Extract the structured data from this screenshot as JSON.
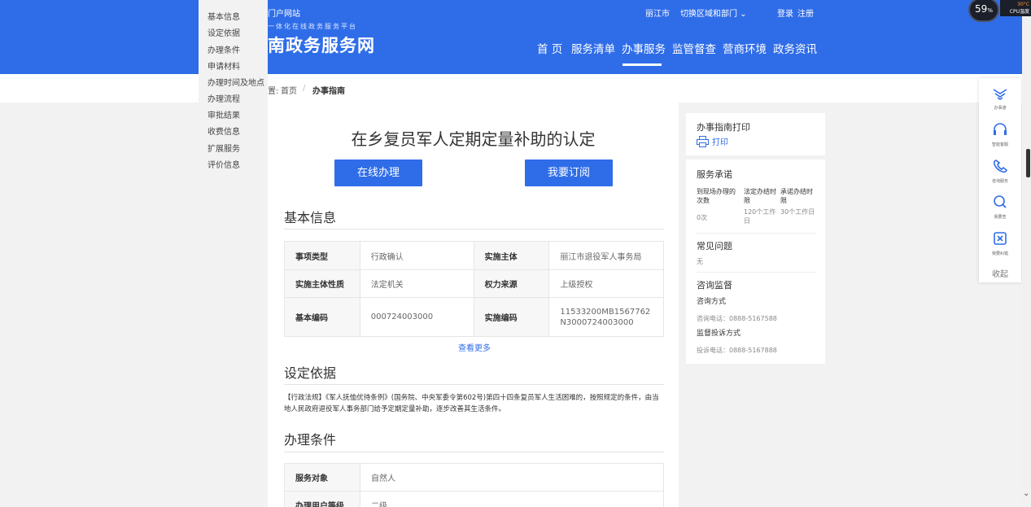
{
  "header": {
    "site_link": "门户网站",
    "tagline": "一体化在线政务服务平台",
    "site_name": "南政务服务网",
    "city": "丽江市",
    "switch_region": "切换区域和部门 ⌄",
    "login": "登录",
    "register": "注册",
    "nav": [
      "首 页",
      "服务清单",
      "办事服务",
      "监管督查",
      "营商环境",
      "政务资讯"
    ]
  },
  "breadcrumb": {
    "prefix": "置:",
    "home": "首页",
    "separator": "/",
    "current": "办事指南"
  },
  "side_menu": [
    "基本信息",
    "设定依据",
    "办理条件",
    "申请材料",
    "办理时间及地点",
    "办理流程",
    "审批结果",
    "收费信息",
    "扩展服务",
    "评价信息"
  ],
  "main": {
    "title": "在乡复员军人定期定量补助的认定",
    "online_button": "在线办理",
    "subscribe_button": "我要订阅",
    "basic_info_title": "基本信息",
    "basic_info_rows": [
      [
        "事项类型",
        "行政确认",
        "实施主体",
        "丽江市退役军人事务局"
      ],
      [
        "实施主体性质",
        "法定机关",
        "权力来源",
        "上级授权"
      ],
      [
        "基本编码",
        "000724003000",
        "实施编码",
        "11533200MB1567762N3000724003000"
      ]
    ],
    "more_link": "查看更多",
    "basis_title": "设定依据",
    "basis_text": "【行政法规】《军人抚恤优待条例》(国务院、中央军委令第602号)第四十四条复员军人生活困难的，按照规定的条件，由当地人民政府退役军人事务部门给予定期定量补助，逐步改善其生活条件。",
    "conditions_title": "办理条件",
    "conditions_rows": [
      [
        "服务对象",
        "自然人"
      ],
      [
        "办理用户等级",
        "二级"
      ]
    ]
  },
  "right": {
    "print_title": "办事指南打印",
    "print_link": "打印",
    "promise_title": "服务承诺",
    "promise_headers": [
      "到现场办理的次数",
      "法定办结时限",
      "承诺办结时限"
    ],
    "promise_values": [
      "0次",
      "120个工作日",
      "30个工作日"
    ],
    "faq_title": "常见问题",
    "faq_value": "无",
    "consult_title": "咨询监督",
    "consult_method_label": "咨询方式",
    "consult_phone": "咨询电话：0888-5167588",
    "complaint_label": "监督投诉方式",
    "complaint_phone": "投诉电话：0888-5167888"
  },
  "float_toolbar": {
    "items": [
      "办事通",
      "智能客服",
      "咨询服务",
      "我要查",
      "我要纠错"
    ],
    "collapse": "收起"
  },
  "cpu_widget": {
    "usage": "59",
    "usage_unit": "%",
    "temp": "30°C",
    "label": "CPU温度"
  },
  "colors": {
    "brand_blue": "#2f6de8",
    "page_bg": "#f2f2f2"
  }
}
